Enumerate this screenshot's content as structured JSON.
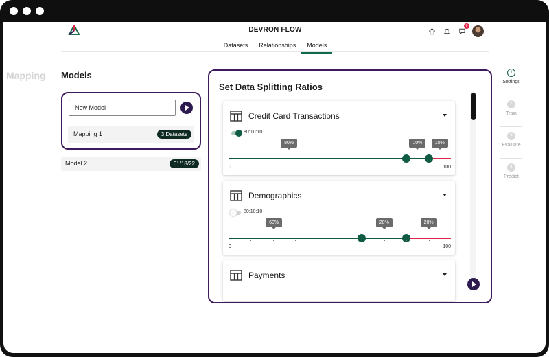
{
  "app": {
    "title": "DEVRON FLOW"
  },
  "header": {
    "notification_count": "6",
    "tabs": [
      {
        "label": "Datasets"
      },
      {
        "label": "Relationships"
      },
      {
        "label": "Models"
      }
    ]
  },
  "sidebar": {
    "mapping_label": "Mapping"
  },
  "models": {
    "title": "Models",
    "new_model_value": "New Model",
    "mapping_row": {
      "label": "Mapping 1",
      "badge": "3 Datasets"
    },
    "model2": {
      "label": "Model 2",
      "badge": "01/18/22"
    }
  },
  "panel": {
    "title": "Set Data Splitting Ratios",
    "datasets": [
      {
        "name": "Credit Card Transactions",
        "toggle_label": "80:10:10",
        "toggle_on": true,
        "splits": [
          "80%",
          "10%",
          "10%"
        ],
        "split_values": [
          80,
          10,
          10
        ],
        "scale_min": "0",
        "scale_max": "100"
      },
      {
        "name": "Demographics",
        "toggle_label": "80:10:10",
        "toggle_on": false,
        "splits": [
          "60%",
          "20%",
          "20%"
        ],
        "split_values": [
          60,
          20,
          20
        ],
        "scale_min": "0",
        "scale_max": "100"
      },
      {
        "name": "Payments"
      }
    ]
  },
  "stepper": [
    {
      "number": "1",
      "label": "Settings",
      "active": true
    },
    {
      "number": "2",
      "label": "Train",
      "active": false
    },
    {
      "number": "3",
      "label": "Evaluate",
      "active": false
    },
    {
      "number": "4",
      "label": "Predict",
      "active": false
    }
  ],
  "colors": {
    "accent_purple": "#3c1a5b",
    "train_green": "#0f5b44",
    "test_red": "#e0284a",
    "active_tab": "#0f6b4e"
  }
}
